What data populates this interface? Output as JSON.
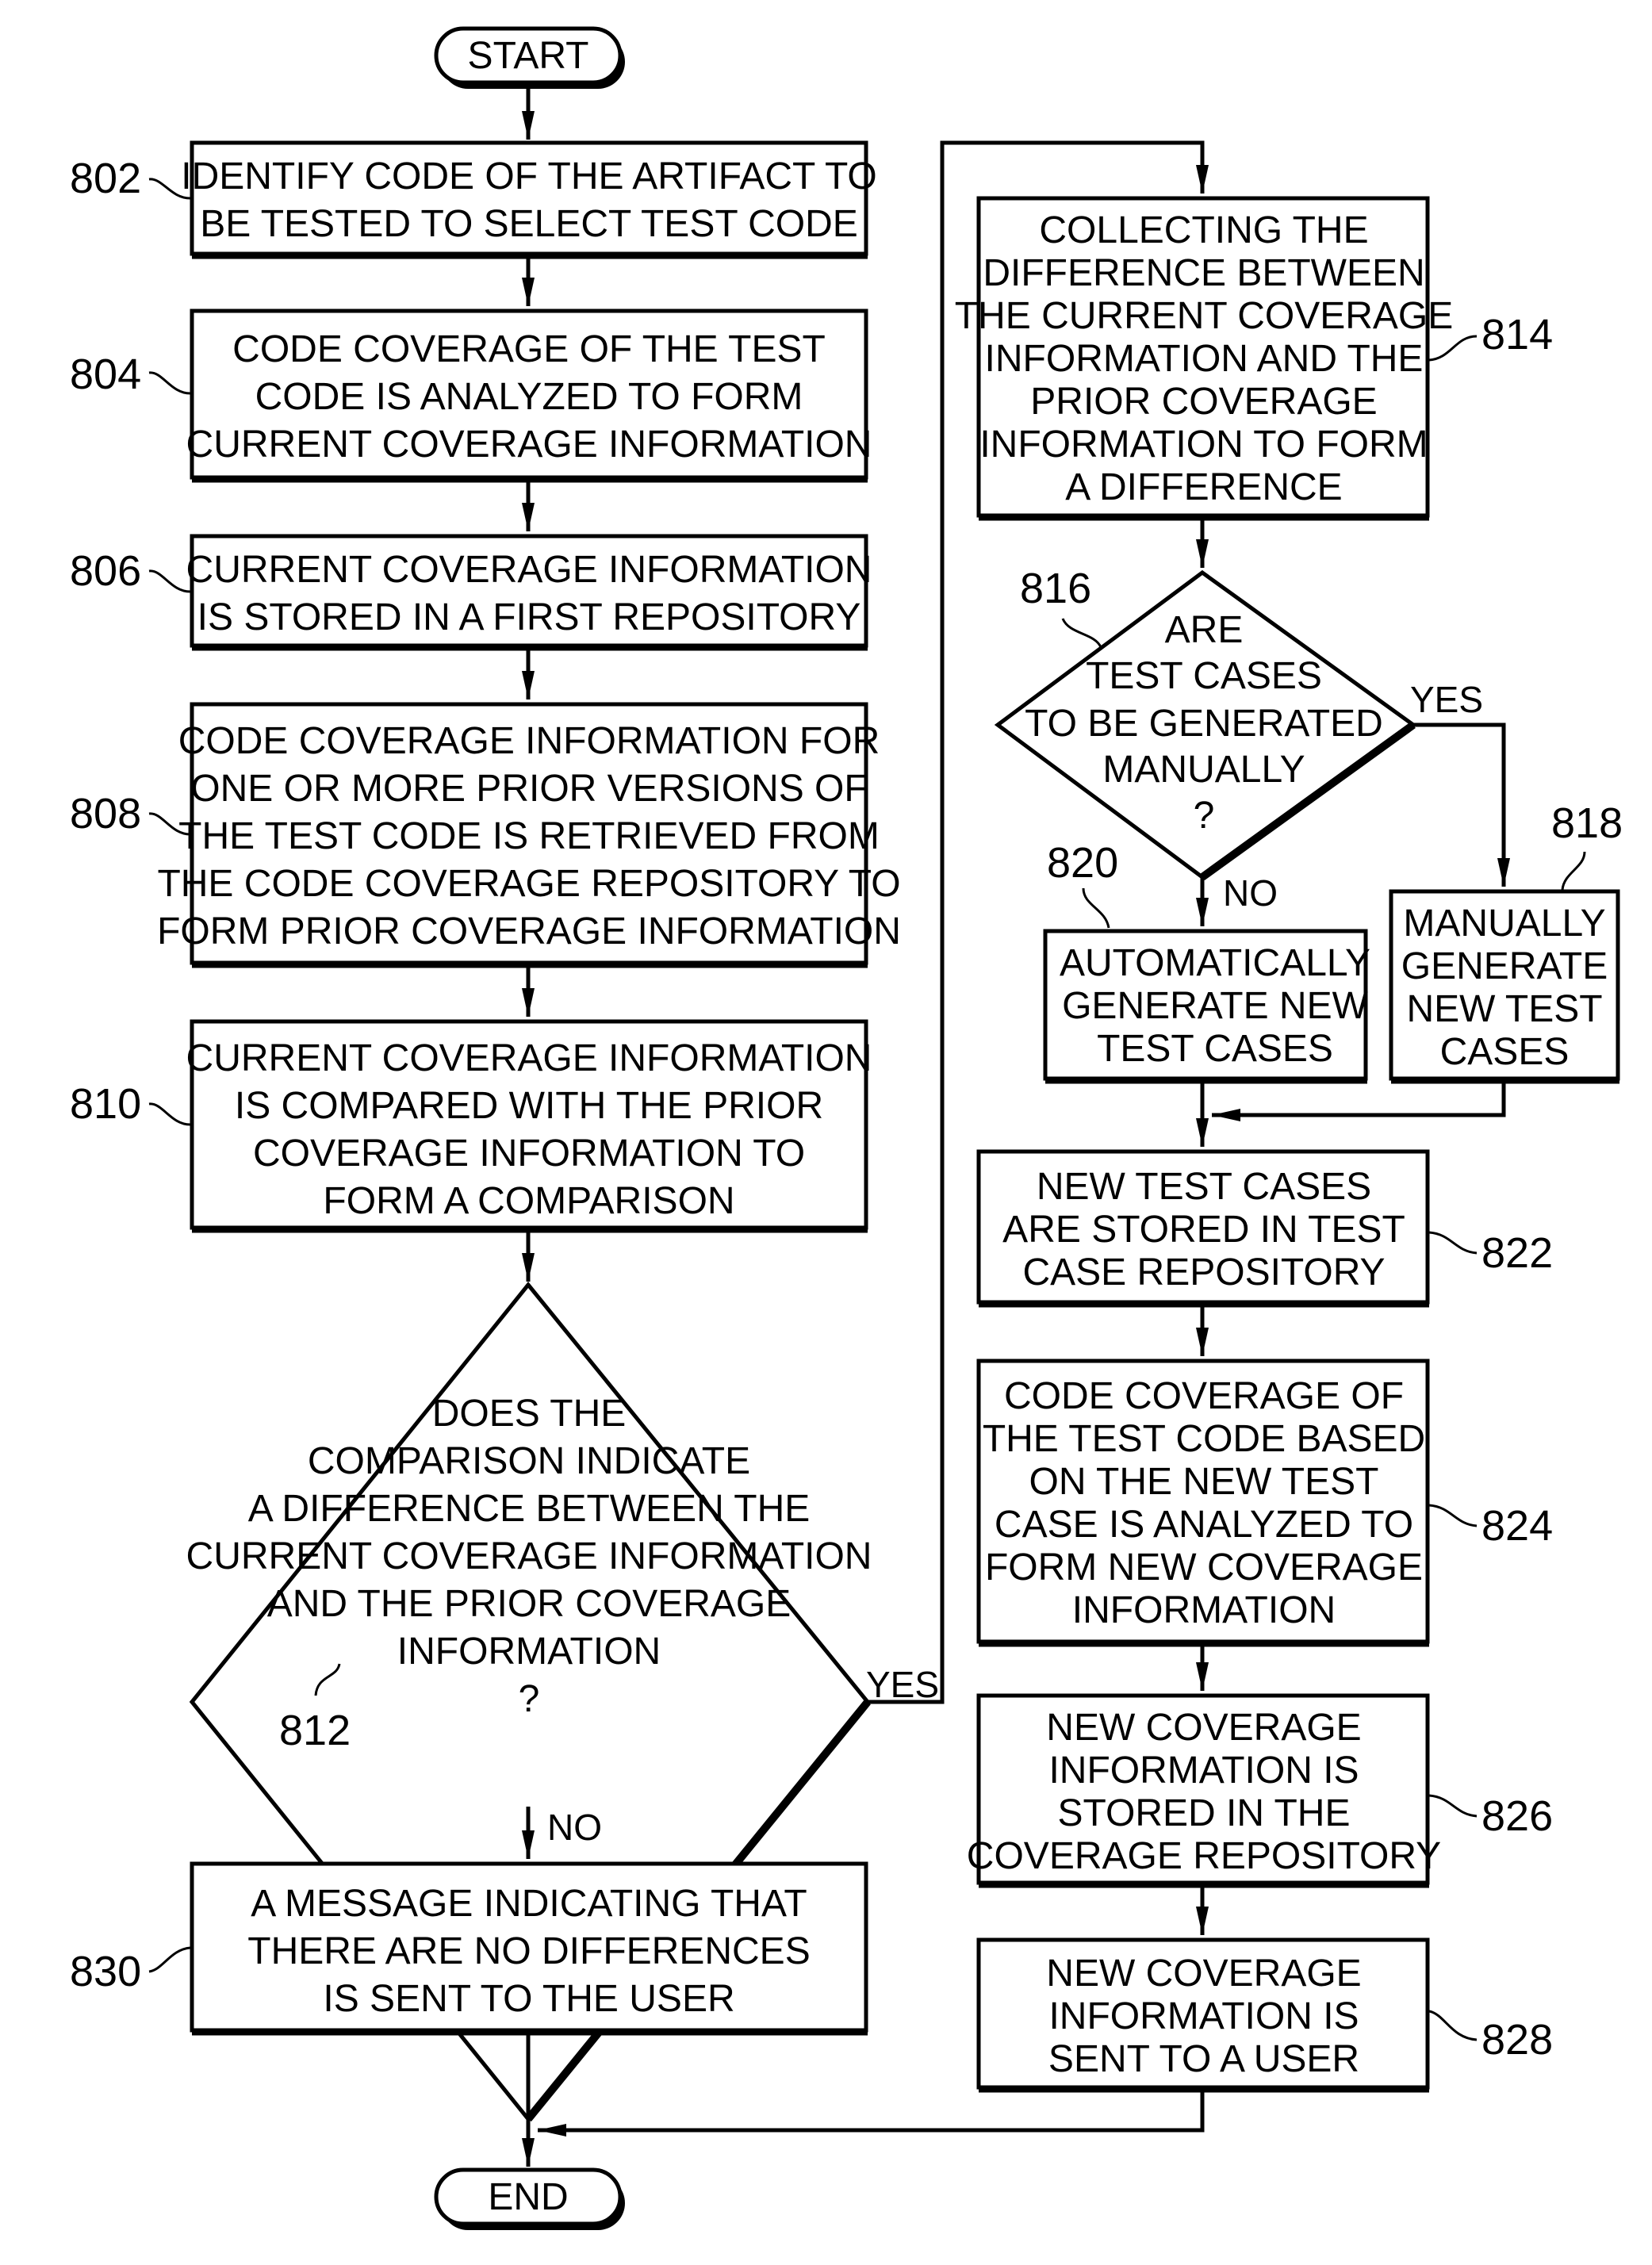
{
  "figure": {
    "terminals": {
      "start": "START",
      "end": "END"
    },
    "steps": [
      {
        "id": "802",
        "ref": "802",
        "lines": [
          "IDENTIFY CODE OF THE ARTIFACT TO",
          "BE TESTED TO SELECT TEST CODE"
        ]
      },
      {
        "id": "804",
        "ref": "804",
        "lines": [
          "CODE COVERAGE OF THE TEST",
          "CODE IS ANALYZED TO FORM",
          "CURRENT COVERAGE INFORMATION"
        ]
      },
      {
        "id": "806",
        "ref": "806",
        "lines": [
          "CURRENT COVERAGE INFORMATION",
          "IS STORED IN A FIRST REPOSITORY"
        ]
      },
      {
        "id": "808",
        "ref": "808",
        "lines": [
          "CODE COVERAGE INFORMATION FOR",
          "ONE OR MORE PRIOR VERSIONS OF",
          "THE TEST CODE IS RETRIEVED FROM",
          "THE CODE COVERAGE REPOSITORY TO",
          "FORM PRIOR COVERAGE INFORMATION"
        ]
      },
      {
        "id": "810",
        "ref": "810",
        "lines": [
          "CURRENT COVERAGE INFORMATION",
          "IS COMPARED WITH THE PRIOR",
          "COVERAGE INFORMATION TO",
          "FORM A COMPARISON"
        ]
      },
      {
        "id": "830",
        "ref": "830",
        "lines": [
          "A MESSAGE INDICATING THAT",
          "THERE ARE NO DIFFERENCES",
          "IS SENT TO THE USER"
        ]
      },
      {
        "id": "814",
        "ref": "814",
        "lines": [
          "COLLECTING THE",
          "DIFFERENCE BETWEEN",
          "THE CURRENT COVERAGE",
          "INFORMATION AND THE",
          "PRIOR COVERAGE",
          "INFORMATION TO FORM",
          "A DIFFERENCE"
        ]
      },
      {
        "id": "820",
        "ref": "820",
        "lines": [
          "AUTOMATICALLY",
          "GENERATE NEW",
          "TEST CASES"
        ]
      },
      {
        "id": "818",
        "ref": "818",
        "lines": [
          "MANUALLY",
          "GENERATE",
          "NEW TEST",
          "CASES"
        ]
      },
      {
        "id": "822",
        "ref": "822",
        "lines": [
          "NEW TEST CASES",
          "ARE STORED IN TEST",
          "CASE REPOSITORY"
        ]
      },
      {
        "id": "824",
        "ref": "824",
        "lines": [
          "CODE COVERAGE OF",
          "THE TEST CODE BASED",
          "ON THE NEW TEST",
          "CASE IS ANALYZED TO",
          "FORM NEW COVERAGE",
          "INFORMATION"
        ]
      },
      {
        "id": "826",
        "ref": "826",
        "lines": [
          "NEW COVERAGE",
          "INFORMATION IS",
          "STORED IN THE",
          "COVERAGE REPOSITORY"
        ]
      },
      {
        "id": "828",
        "ref": "828",
        "lines": [
          "NEW COVERAGE",
          "INFORMATION IS",
          "SENT TO A USER"
        ]
      }
    ],
    "decisions": [
      {
        "id": "812",
        "ref": "812",
        "lines": [
          "DOES THE",
          "COMPARISON INDICATE",
          "A DIFFERENCE BETWEEN THE",
          "CURRENT COVERAGE INFORMATION",
          "AND THE PRIOR COVERAGE",
          "INFORMATION",
          "?"
        ],
        "yes_label": "YES",
        "no_label": "NO"
      },
      {
        "id": "816",
        "ref": "816",
        "lines": [
          "ARE",
          "TEST CASES",
          "TO BE GENERATED",
          "MANUALLY",
          "?"
        ],
        "yes_label": "YES",
        "no_label": "NO"
      }
    ]
  }
}
